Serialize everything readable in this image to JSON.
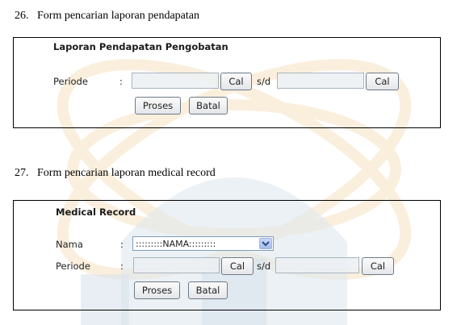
{
  "section_26": {
    "number": "26.",
    "caption": "Form pencarian laporan pendapatan",
    "form": {
      "title": "Laporan Pendapatan Pengobatan",
      "periode_label": "Periode",
      "colon": ":",
      "start_value": "",
      "cal_label": "Cal",
      "sd_label": "s/d",
      "end_value": "",
      "proses_label": "Proses",
      "batal_label": "Batal"
    }
  },
  "section_27": {
    "number": "27.",
    "caption": "Form pencarian laporan medical record",
    "form": {
      "title": "Medical Record",
      "nama_label": "Nama",
      "nama_selected": ":::::::::NAMA:::::::::",
      "periode_label": "Periode",
      "colon": ":",
      "start_value": "",
      "cal_label": "Cal",
      "sd_label": "s/d",
      "end_value": "",
      "proses_label": "Proses",
      "batal_label": "Batal"
    }
  },
  "icons": {
    "dropdown": "chevron-down-icon"
  }
}
